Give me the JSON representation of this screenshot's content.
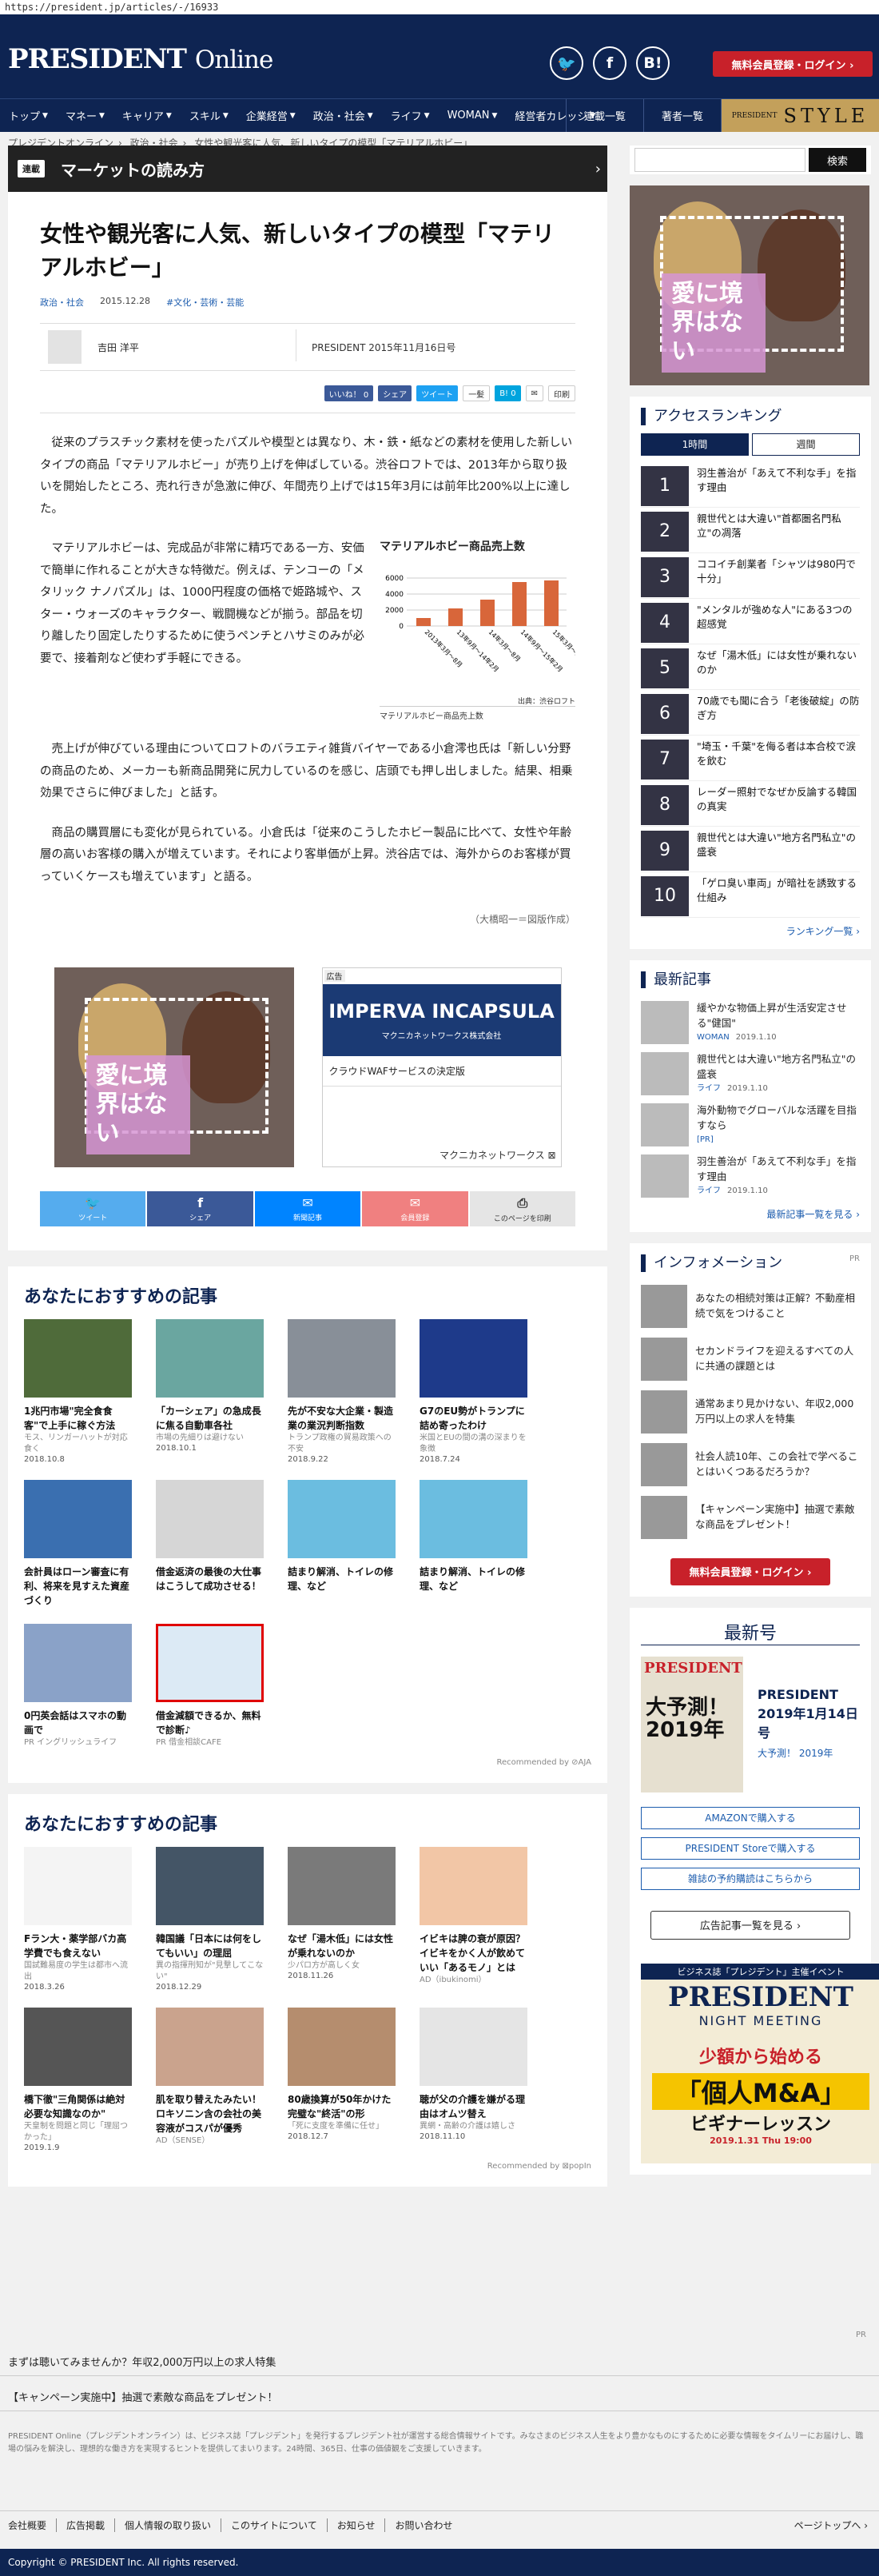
{
  "browser": {
    "url": "https://president.jp/articles/-/16933"
  },
  "header": {
    "logo_main": "PRESIDENT",
    "logo_sub": "Online",
    "sns": [
      "twitter-icon",
      "facebook-icon",
      "hatena-icon"
    ],
    "sns_glyphs": [
      "🐦",
      "f",
      "B!"
    ],
    "register_label": "無料会員登録・ログイン ›"
  },
  "nav": {
    "items": [
      "トップ",
      "マネー",
      "キャリア",
      "スキル",
      "企業経営",
      "政治・社会",
      "ライフ",
      "WOMAN",
      "経営者カレッジ"
    ],
    "serial": "連載一覧",
    "authors": "著者一覧",
    "style_small": "PRESIDENT",
    "style": "STYLE"
  },
  "breadcrumb": [
    "プレジデントオンライン",
    "政治・社会",
    "女性や観光客に人気、新しいタイプの模型「マテリアルホビー」"
  ],
  "category_bar": {
    "tag": "連載",
    "title": "マーケットの読み方"
  },
  "article": {
    "title": "女性や観光客に人気、新しいタイプの模型「マテリアルホビー」",
    "category": "政治・社会",
    "date": "2015.12.28",
    "tags": "#文化・芸術・芸能",
    "author": "吉田 洋平",
    "publication": "PRESIDENT 2015年11月16日号",
    "share": {
      "like": "いいね！ 0",
      "share": "シェア",
      "tweet": "ツイート",
      "ippatsu": "一髪",
      "hatena": "B! 0",
      "mail": "✉",
      "print": "印刷"
    },
    "lead": "従来のプラスチック素材を使ったパズルや模型とは異なり、木・鉄・紙などの素材を使用した新しいタイプの商品「マテリアルホビー」が売り上げを伸ばしている。渋谷ロフトでは、2013年から取り扱いを開始したところ、売れ行きが急激に伸び、年間売り上げでは15年3月には前年比200%以上に達した。",
    "p2": "マテリアルホビーは、完成品が非常に精巧である一方、安価で簡単に作れることが大きな特徴だ。例えば、テンコーの「メタリック ナノパズル」は、1000円程度の価格で姫路城や、スター・ウォーズのキャラクター、戦闘機などが揃う。部品を切り離したり固定したりするために使うペンチとハサミのみが必要で、接着剤など使わず手軽にできる。",
    "p3": "売上げが伸びている理由についてロフトのバラエティ雑貨バイヤーである小倉澪也氏は「新しい分野の商品のため、メーカーも新商品開発に尻力しているのを感じ、店頭でも押し出しました。結果、相乗効果でさらに伸びました」と話す。",
    "p4": "商品の購買層にも変化が見られている。小倉氏は「従来のこうしたホビー製品に比べて、女性や年齢層の高いお客様の購入が増えています。それにより客単価が上昇。渋谷店では、海外からのお客様が買っていくケースも増えています」と語る。",
    "credit": "（大橋昭一＝図版作成）"
  },
  "chart_data": {
    "type": "bar",
    "title": "マテリアルホビー商品売上数",
    "categories": [
      "2013年3月～8月",
      "13年9月～14年2月",
      "14年3月～8月",
      "14年9月～15年2月",
      "15年3月～8月"
    ],
    "values": [
      1000,
      2200,
      3300,
      5500,
      5700
    ],
    "ylim": [
      0,
      8000
    ],
    "yticks": [
      0,
      2000,
      4000,
      6000
    ],
    "source": "出典：渋谷ロフト",
    "caption": "マテリアルホビー商品売上数",
    "bar_color": "#d8663a"
  },
  "ads": {
    "kids_text": "愛に境界はない",
    "imperva_label": "広告",
    "imperva_brand": "IMPERVA INCAPSULA",
    "imperva_company": "マクニカネットワークス株式会社",
    "imperva_line": "クラウドWAFサービスの決定版",
    "imperva_footer": "マクニカネットワークス ⊠"
  },
  "share_bar": [
    {
      "glyph": "🐦",
      "label": "ツイート",
      "color": "#55acee"
    },
    {
      "glyph": "f",
      "label": "シェア",
      "color": "#3b5998"
    },
    {
      "glyph": "✉",
      "label": "新聞記事",
      "color": "#0084ff"
    },
    {
      "glyph": "✉",
      "label": "会員登録",
      "color": "#f08080"
    },
    {
      "glyph": "⎙",
      "label": "このページを印刷",
      "color": "#e5e5e5"
    }
  ],
  "reco1": {
    "heading": "あなたにおすすめの記事",
    "items": [
      {
        "title": "1兆円市場\"完全食食客\"で上手に稼ぐ方法",
        "sub": "モス、リンガーハットが対応食く",
        "date": "2018.10.8",
        "color": "#4f6b3a"
      },
      {
        "title": "「カーシェア」の急成長に焦る自動車各社",
        "sub": "市場の先細りは避けない",
        "date": "2018.10.1",
        "color": "#6aa6a0"
      },
      {
        "title": "先が不安な大企業・製造業の業況判断指数",
        "sub": "トランプ政権の貿易政策への不安",
        "date": "2018.9.22",
        "color": "#888f98"
      },
      {
        "title": "G7のEU勢がトランプに詰め寄ったわけ",
        "sub": "米国とEUの間の溝の深まりを象徴",
        "date": "2018.7.24",
        "color": "#1e3a8a"
      },
      {
        "title": "会計員はローン審査に有利、将来を見すえた資産づくり",
        "sub": "",
        "date": "",
        "color": "#3a6fb0"
      },
      {
        "title": "借金返済の最後の大仕事はこうして成功させる！",
        "sub": "",
        "date": "",
        "color": "#d6d6d6"
      },
      {
        "title": "詰まり解消、トイレの修理、など",
        "sub": "",
        "date": "",
        "color": "#6bbde0"
      },
      {
        "title": "詰まり解消、トイレの修理、など",
        "sub": "",
        "date": "",
        "color": "#6bbde0"
      },
      {
        "title": "0円英会話はスマホの動画で",
        "sub": "PR イングリッシュライフ",
        "date": "",
        "color": "#8aa2c8"
      },
      {
        "title": "借金減額できるか、無料で診断♪",
        "sub": "PR 借金相談CAFE",
        "date": "",
        "color": "#dceaf5"
      }
    ],
    "recommended_by": "Recommended by  ⊘AJA"
  },
  "reco2": {
    "heading": "あなたにおすすめの記事",
    "items": [
      {
        "title": "Fラン大・薬学部バカ高学費でも食えない",
        "sub": "国試難易度の学生は都市へ流出",
        "date": "2018.3.26",
        "color": "#f4f4f4"
      },
      {
        "title": "韓国議「日本には何をしてもいい」の理屈",
        "sub": "異の指揮刑知が\"見撃してこない\"",
        "date": "2018.12.29",
        "color": "#445566"
      },
      {
        "title": "なぜ「湯木低」には女性が乗れないのか",
        "sub": "少パロ方が高しく女",
        "date": "2018.11.26",
        "color": "#7a7a7a"
      },
      {
        "title": "イビキは脾の衰が原因？イビキをかく人が飲めていい「あるモノ」とは",
        "sub": "AD（ibukinomi）",
        "date": "",
        "color": "#f2c6a6"
      },
      {
        "title": "橋下徹\"三角関係は絶対必要な知識なのか\"",
        "sub": "天皇制を問題と同じ「理屈つかった」",
        "date": "2019.1.9",
        "color": "#555"
      },
      {
        "title": "肌を取り替えたみたい！ロキソニン含の会社の美容液がコスパが優秀",
        "sub": "AD（SENSE）",
        "date": "",
        "color": "#caa38d"
      },
      {
        "title": "80歳換算が50年かけた完璧な\"終活\"の形",
        "sub": "「死に支度を準備に任せ」",
        "date": "2018.12.7",
        "color": "#b58d6e"
      },
      {
        "title": "聴が父の介護を嫌がる理由はオムツ替え",
        "sub": "異網・高齢の介護は嬉しさ",
        "date": "2018.11.10",
        "color": "#e5e5e5"
      }
    ],
    "recommended_by": "Recommended by  ⊠popIn"
  },
  "sidebar": {
    "search_label": "検索",
    "ranking_heading": "アクセスランキング",
    "tabs": [
      "1時間",
      "週間"
    ],
    "ranking": [
      "羽生善治が「あえて不利な手」を指す理由",
      "親世代とは大違い\"首都圏名門私立\"の凋落",
      "ココイチ創業者「シャツは980円で十分」",
      "\"メンタルが強めな人\"にある3つの超感覚",
      "なぜ「湯木低」には女性が乗れないのか",
      "70歳でも聞に合う「老後破綻」の防ぎ方",
      "\"埼玉・千葉\"を侮る者は本合校で涙を飲む",
      "レーダー照射でなぜか反論する韓国の真実",
      "親世代とは大違い\"地方名門私立\"の盛衰",
      "「ゲロ臭い車両」が暗社を誘致する仕組み"
    ],
    "ranking_more": "ランキング一覧 ›",
    "latest_heading": "最新記事",
    "latest": [
      {
        "title": "緩やかな物価上昇が生活安定させる\"健国\"",
        "cat": "WOMAN",
        "date": "2019.1.10"
      },
      {
        "title": "親世代とは大違い\"地方名門私立\"の盛衰",
        "cat": "ライフ",
        "date": "2019.1.10"
      },
      {
        "title": "海外動物でグローバルな活躍を目指すなら",
        "cat": "[PR]",
        "date": ""
      },
      {
        "title": "羽生善治が「あえて不利な手」を指す理由",
        "cat": "ライフ",
        "date": "2019.1.10"
      }
    ],
    "latest_more": "最新記事一覧を見る ›",
    "info_heading": "インフォメーション",
    "info_pr": "PR",
    "info": [
      "あなたの相続対策は正解？不動産相続で気をつけること",
      "セカンドライフを迎えるすべての人に共通の課題とは",
      "通常あまり見かけない、年収2,000万円以上の求人を特集",
      "社会人読10年、この会社で学べることはいくつあるだろうか？",
      "【キャンペーン実施中】抽選で素敵な商品をプレゼント！"
    ],
    "register_label": "無料会員登録・ログイン ›",
    "issue_heading": "最新号",
    "issue_cover_brand": "PRESIDENT",
    "issue_cover_text": "大予測！2019年",
    "issue_title": "PRESIDENT 2019年1月14日号",
    "issue_sub": "大予測！ 2019年",
    "issue_buttons": [
      "AMAZONで購入する",
      "PRESIDENT Storeで購入する",
      "雑誌の予約購読はこちらから"
    ],
    "ad_button": "広告記事一覧を見る ›",
    "ad3": {
      "a": "ビジネス誌「プレジデント」主催イベント",
      "b": "PRESIDENT",
      "c": "NIGHT MEETING",
      "d": "少額から始める",
      "e": "「個人M&A」",
      "f": "ビギナーレッスン",
      "g": "2019.1.31 Thu 19:00"
    }
  },
  "footer": {
    "pr": "PR",
    "link1": "まずは聴いてみませんか？年収2,000万円以上の求人特集",
    "link2": "【キャンペーン実施中】抽選で素敵な商品をプレゼント！",
    "desc": "PRESIDENT Online（プレジデントオンライン）は、ビジネス誌「プレジデント」を発行するプレジデント社が運営する総合情報サイトです。みなさまのビジネス人生をより豊かなものにするために必要な情報をタイムリーにお届けし、職場の悩みを解決し、理想的な働き方を実現するヒントを提供してまいります。24時間、365日、仕事の価値観をご支援していきます。",
    "nav": [
      "会社概要",
      "広告掲載",
      "個人情報の取り扱い",
      "このサイトについて",
      "お知らせ",
      "お問い合わせ"
    ],
    "top": "ページトップへ ›",
    "copyright": "Copyright © PRESIDENT Inc. All rights reserved."
  }
}
